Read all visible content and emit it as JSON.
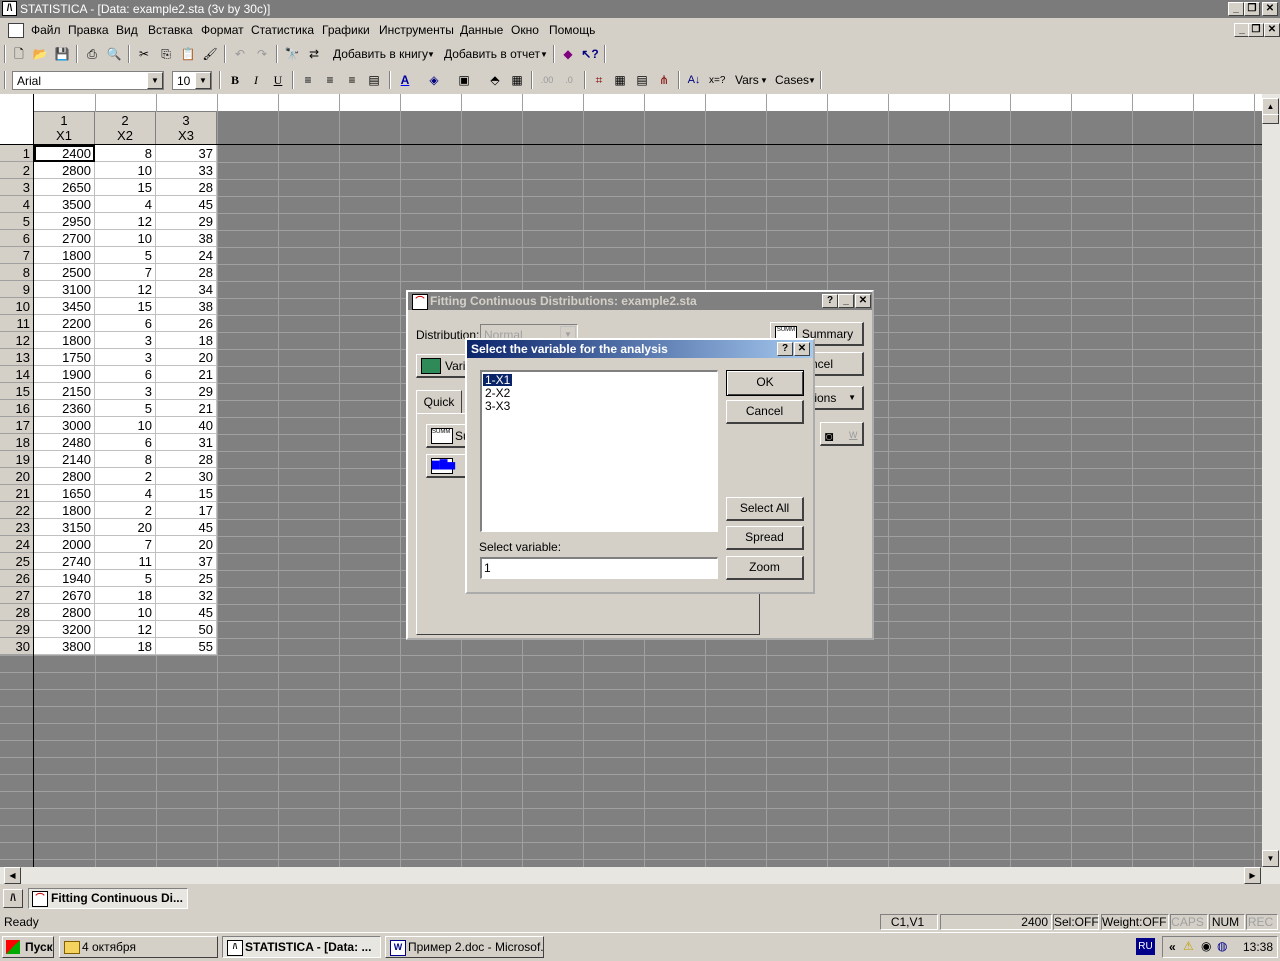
{
  "window": {
    "title": "STATISTICA - [Data: example2.sta (3v by 30c)]",
    "app_icon": "statistica-icon"
  },
  "menu": [
    "Файл",
    "Правка",
    "Вид",
    "Вставка",
    "Формат",
    "Статистика",
    "Графики",
    "Инструменты",
    "Данные",
    "Окно",
    "Помощь"
  ],
  "toolbar": {
    "add_to_book": "Добавить в книгу",
    "add_to_report": "Добавить в отчет",
    "font_name": "Arial",
    "font_size": "10",
    "bold": "B",
    "italic": "I",
    "underline": "U",
    "vars": "Vars",
    "cases": "Cases",
    "sort_label": "x=?"
  },
  "sheet": {
    "columns": [
      {
        "num": "1",
        "name": "X1"
      },
      {
        "num": "2",
        "name": "X2"
      },
      {
        "num": "3",
        "name": "X3"
      }
    ],
    "rows": [
      [
        2400,
        8,
        37
      ],
      [
        2800,
        10,
        33
      ],
      [
        2650,
        15,
        28
      ],
      [
        3500,
        4,
        45
      ],
      [
        2950,
        12,
        29
      ],
      [
        2700,
        10,
        38
      ],
      [
        1800,
        5,
        24
      ],
      [
        2500,
        7,
        28
      ],
      [
        3100,
        12,
        34
      ],
      [
        3450,
        15,
        38
      ],
      [
        2200,
        6,
        26
      ],
      [
        1800,
        3,
        18
      ],
      [
        1750,
        3,
        20
      ],
      [
        1900,
        6,
        21
      ],
      [
        2150,
        3,
        29
      ],
      [
        2360,
        5,
        21
      ],
      [
        3000,
        10,
        40
      ],
      [
        2480,
        6,
        31
      ],
      [
        2140,
        8,
        28
      ],
      [
        2800,
        2,
        30
      ],
      [
        1650,
        4,
        15
      ],
      [
        1800,
        2,
        17
      ],
      [
        3150,
        20,
        45
      ],
      [
        2000,
        7,
        20
      ],
      [
        2740,
        11,
        37
      ],
      [
        1940,
        5,
        25
      ],
      [
        2670,
        18,
        32
      ],
      [
        2800,
        10,
        45
      ],
      [
        3200,
        12,
        50
      ],
      [
        3800,
        18,
        55
      ]
    ]
  },
  "fit_dialog": {
    "title": "Fitting Continuous Distributions: example2.sta",
    "distribution_label": "Distribution:",
    "distribution_value": "Normal",
    "summary_button": "Summary",
    "cancel_partial": "ncel",
    "variables_partial": "Varia",
    "options_partial": "tions",
    "tab_quick": "Quick",
    "summary_partial": "Su",
    "w_label": "W"
  },
  "select_dialog": {
    "title": "Select the variable for the analysis",
    "help": "?",
    "close": "X",
    "items": [
      "1-X1",
      "2-X2",
      "3-X3"
    ],
    "ok": "OK",
    "cancel": "Cancel",
    "select_all": "Select All",
    "spread": "Spread",
    "zoom": "Zoom",
    "select_variable_label": "Select variable:",
    "select_variable_value": "1"
  },
  "mdi_tab": "Fitting Continuous Di...",
  "status": {
    "ready": "Ready",
    "cell": "C1,V1",
    "value": "2400",
    "sel": "Sel:OFF",
    "weight": "Weight:OFF",
    "caps": "CAPS",
    "num": "NUM",
    "rec": "REC"
  },
  "taskbar": {
    "start": "Пуск",
    "tasks": [
      "4 октября",
      "STATISTICA - [Data: ...",
      "Пример 2.doc - Microsof..."
    ],
    "lang": "RU",
    "clock": "13:38",
    "chevron": "«"
  }
}
